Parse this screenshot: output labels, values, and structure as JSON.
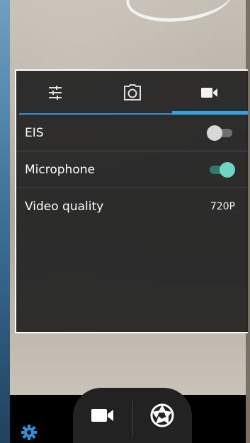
{
  "tabs": [
    {
      "id": "general",
      "icon": "sliders-icon"
    },
    {
      "id": "photo",
      "icon": "camera-icon"
    },
    {
      "id": "video",
      "icon": "video-camera-icon",
      "active": true
    }
  ],
  "settings": {
    "eis": {
      "label": "EIS",
      "enabled": false
    },
    "microphone": {
      "label": "Microphone",
      "enabled": true
    },
    "video_quality": {
      "label": "Video quality",
      "value": "720P"
    }
  },
  "controls": {
    "record_icon": "video-camera-icon",
    "shutter_icon": "aperture-icon",
    "settings_icon": "gear-icon"
  },
  "colors": {
    "accent": "#2fa3e6",
    "switch_on": "#6fd4c3",
    "settings_icon": "#2f8fd8"
  }
}
